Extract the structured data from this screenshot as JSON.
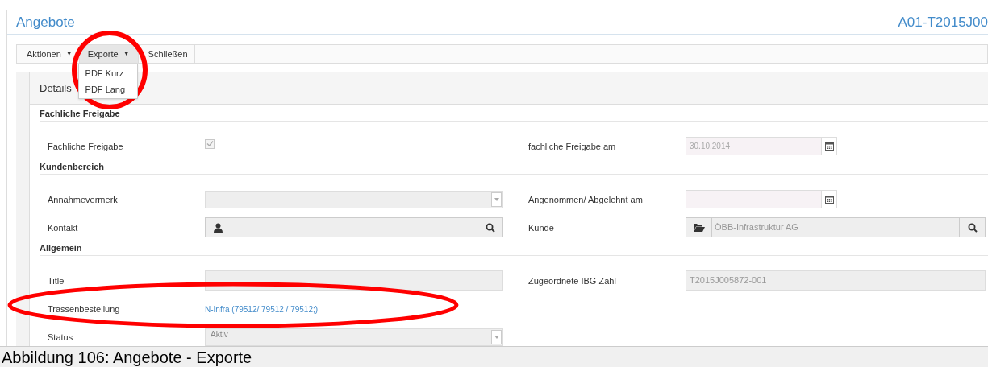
{
  "page": {
    "title": "Angebote",
    "record_id": "A01-T2015J00"
  },
  "toolbar": [
    {
      "label": "Aktionen",
      "caret": "▼",
      "selected": false
    },
    {
      "label": "Exporte",
      "caret": "▼",
      "selected": true
    },
    {
      "label": "Schließen",
      "selected": false
    }
  ],
  "dropdown": {
    "items": [
      "PDF Kurz",
      "PDF Lang"
    ]
  },
  "panel": {
    "title": "Details",
    "sections": [
      {
        "title": "Fachliche Freigabe",
        "rows": [
          [
            {
              "label": "Fachliche Freigabe",
              "kind": "checkbox",
              "checked": true
            },
            {
              "label": "fachliche Freigabe am",
              "kind": "date",
              "value": "30.10.2014"
            }
          ]
        ]
      },
      {
        "title": "Kundenbereich",
        "rows": [
          [
            {
              "label": "Annahmevermerk",
              "kind": "select"
            },
            {
              "label": "Angenommen/ Abgelehnt am",
              "kind": "date"
            }
          ],
          [
            {
              "label": "Kontakt",
              "kind": "person-lookup"
            },
            {
              "label": "Kunde",
              "kind": "folder-lookup",
              "value": "ÖBB-Infrastruktur AG"
            }
          ]
        ]
      },
      {
        "title": "Allgemein",
        "rows": [
          [
            {
              "label": "Title",
              "kind": "text"
            },
            {
              "label": "Zugeordnete IBG Zahl",
              "kind": "text",
              "value": "T2015J005872-001"
            }
          ],
          [
            {
              "label": "Trassenbestellung",
              "kind": "link",
              "value": "N-Infra (79512/ 79512 / 79512;)"
            }
          ],
          [
            {
              "label": "Status",
              "kind": "select",
              "value": "Aktiv"
            }
          ]
        ]
      }
    ]
  },
  "caption": "Abbildung 106: Angebote - Exporte"
}
